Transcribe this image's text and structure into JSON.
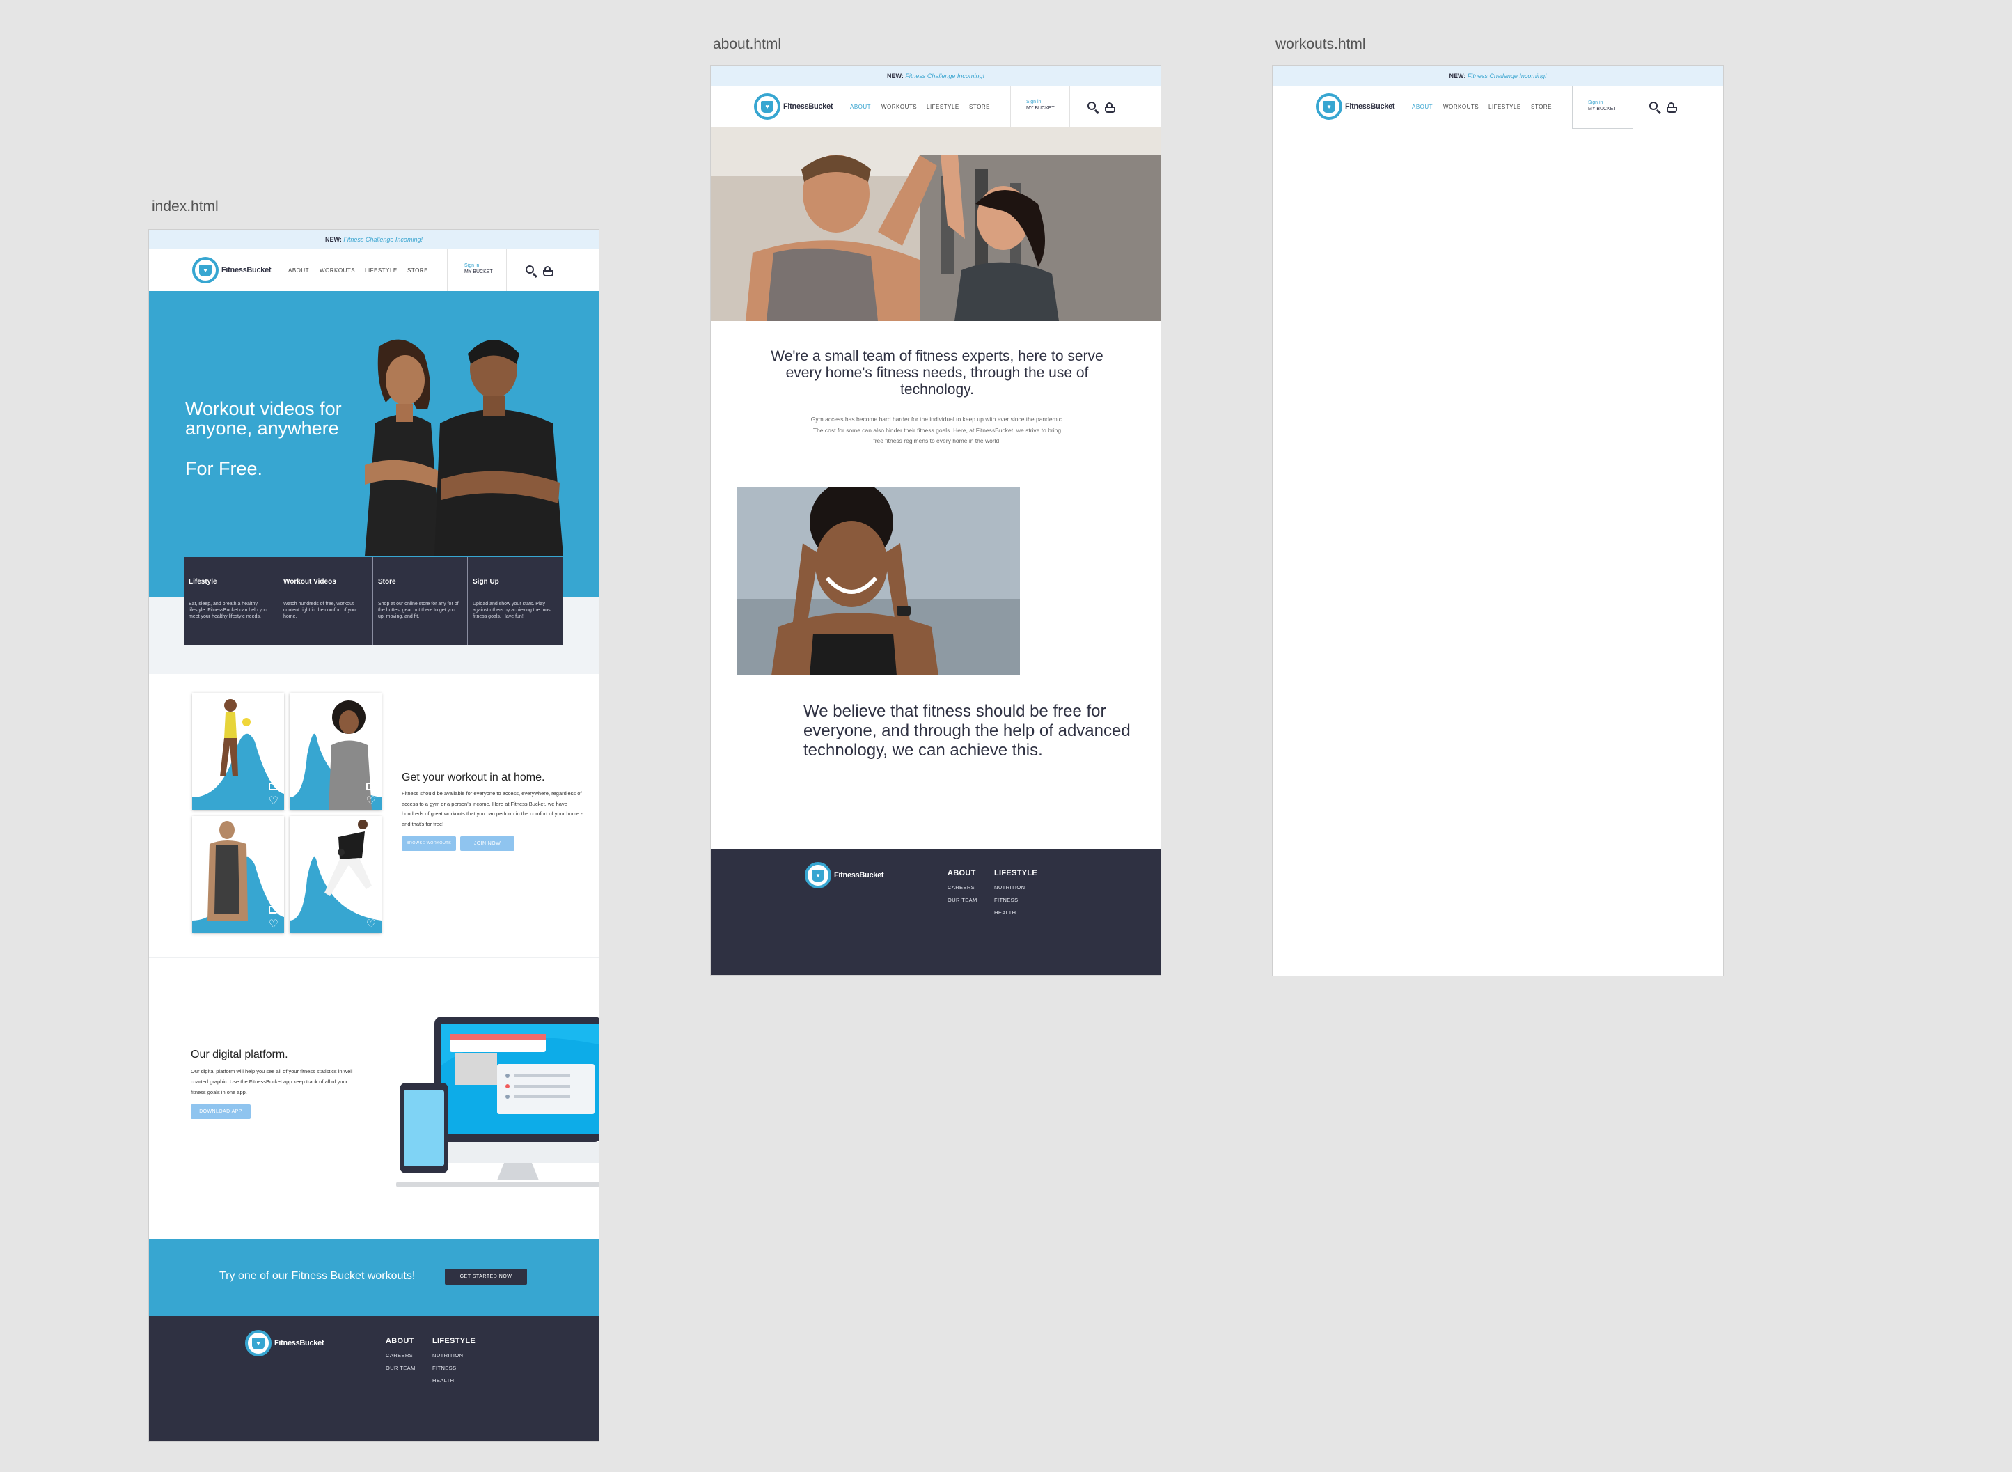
{
  "artboards": {
    "index": {
      "label": "index.html"
    },
    "about": {
      "label": "about.html"
    },
    "workouts": {
      "label": "workouts.html"
    }
  },
  "announcement": {
    "prefix": "NEW:",
    "link": "Fitness Challenge Incoming!"
  },
  "brand": {
    "name": "FitnessBucket",
    "accent": "#37a6d1",
    "dark": "#2f3142",
    "light_button": "#8fc4ef"
  },
  "nav": {
    "links": [
      "ABOUT",
      "WORKOUTS",
      "LIFESTYLE",
      "STORE"
    ],
    "sign_in": "Sign in",
    "my_bucket": "MY BUCKET",
    "search_icon": "search-icon",
    "cart_icon": "basket-icon"
  },
  "index": {
    "hero": {
      "title_line1": "Workout videos for",
      "title_line2": "anyone, anywhere",
      "subtitle": "For Free."
    },
    "features": [
      {
        "title": "Lifestyle",
        "text": "Eat, sleep, and breath a healthy lifestyle. FitnessBucket can help you meet your healthy lifestyle needs."
      },
      {
        "title": "Workout Videos",
        "text": "Watch hundreds of free, workout content right in the comfort of your home."
      },
      {
        "title": "Store",
        "text": "Shop at our online store for any for of the hottest gear out there to get you up, moving, and fit."
      },
      {
        "title": "Sign Up",
        "text": "Upload and show your stats. Play against others by achieving the most fitness goals. Have fun!"
      }
    ],
    "workouts": {
      "title": "Get your workout in at home.",
      "text": "Fitness should be available for everyone to access, everywhere, regardless of access to a gym or a person's income. Here at Fitness Bucket, we have hundreds of great workouts that you can perform in the comfort of your home - and that's for free!",
      "browse_button": "BROWSE WORKOUTS",
      "join_button": "JOIN NOW"
    },
    "platform": {
      "title": "Our digital platform.",
      "text": "Our digital platform will help you see all of your fitness statistics in well charted graphic. Use the FitnessBucket app keep track of all of your fitness goals in one app.",
      "download_button": "DOWNLOAD APP"
    },
    "cta": {
      "text": "Try one of our Fitness Bucket workouts!",
      "button": "GET STARTED NOW"
    }
  },
  "footer": {
    "col1": {
      "heading": "ABOUT",
      "items": [
        "CAREERS",
        "OUR TEAM"
      ]
    },
    "col2": {
      "heading": "LIFESTYLE",
      "items": [
        "NUTRITION",
        "FITNESS",
        "HEALTH"
      ]
    }
  },
  "about": {
    "headline": "We're a small team of fitness experts, here to serve every home's fitness needs, through the use of technology.",
    "paragraph": "Gym access has become hard harder for the individual to keep up with ever since the pandemic. The cost for some can also hinder their fitness goals. Here, at FitnessBucket, we strive to bring free fitness regimens to every home in the world.",
    "belief": "We believe that fitness should be free for everyone, and through the help of advanced technology, we can achieve this."
  }
}
